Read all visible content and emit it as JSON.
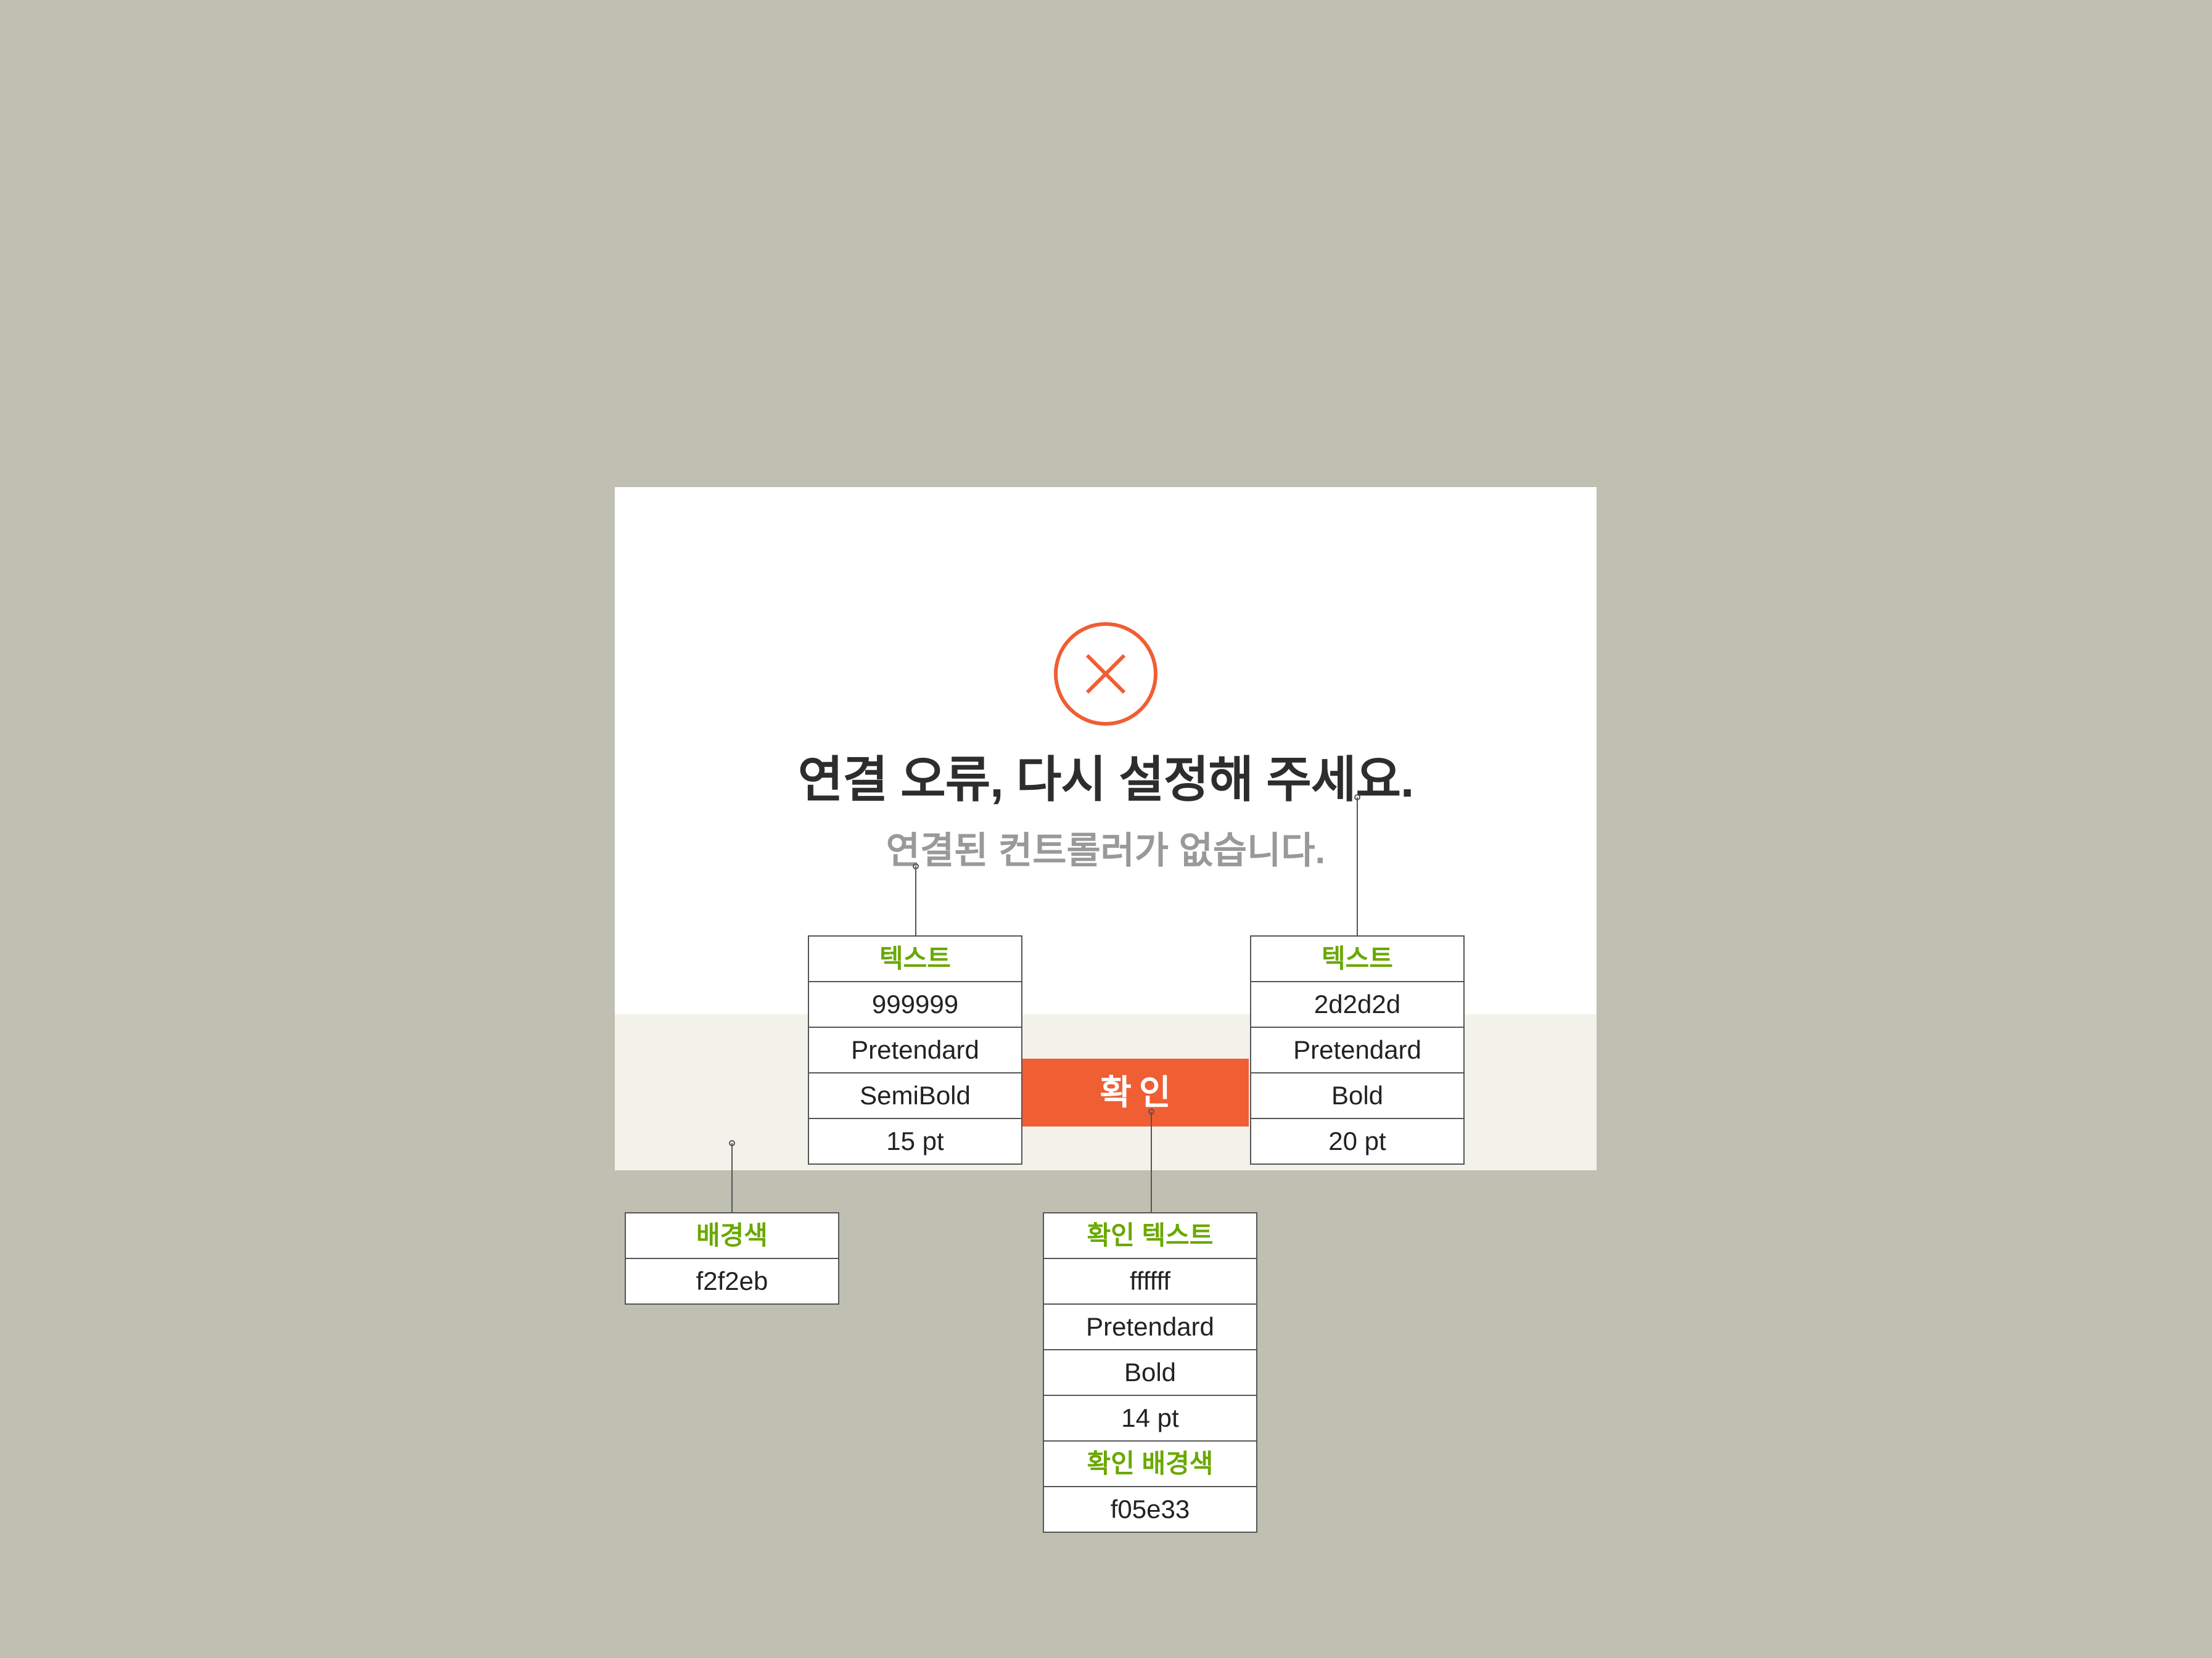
{
  "colors": {
    "page_background": "#bfbfb2",
    "dialog_background": "#ffffff",
    "footer_background": "#f2f2eb",
    "title_text": "#2d2d2d",
    "subtitle_text": "#999999",
    "confirm_background": "#f05e33",
    "confirm_text": "#ffffff",
    "error_icon": "#f05e33",
    "spec_heading": "#6aa800"
  },
  "dialog": {
    "icon": "close-circle-icon",
    "title": "연결 오류, 다시 설정해 주세요.",
    "subtitle": "연결된 컨트롤러가 없습니다.",
    "confirm_label": "확인"
  },
  "annotations": {
    "subtitle_spec": {
      "heading": "텍스트",
      "color": "999999",
      "font": "Pretendard",
      "weight": "SemiBold",
      "size": "15 pt"
    },
    "title_spec": {
      "heading": "텍스트",
      "color": "2d2d2d",
      "font": "Pretendard",
      "weight": "Bold",
      "size": "20 pt"
    },
    "background_spec": {
      "heading": "배경색",
      "color": "f2f2eb"
    },
    "confirm_spec": {
      "text_heading": "확인 텍스트",
      "text_color": "ffffff",
      "font": "Pretendard",
      "weight": "Bold",
      "size": "14 pt",
      "bg_heading": "확인 배경색",
      "bg_color": "f05e33"
    }
  }
}
